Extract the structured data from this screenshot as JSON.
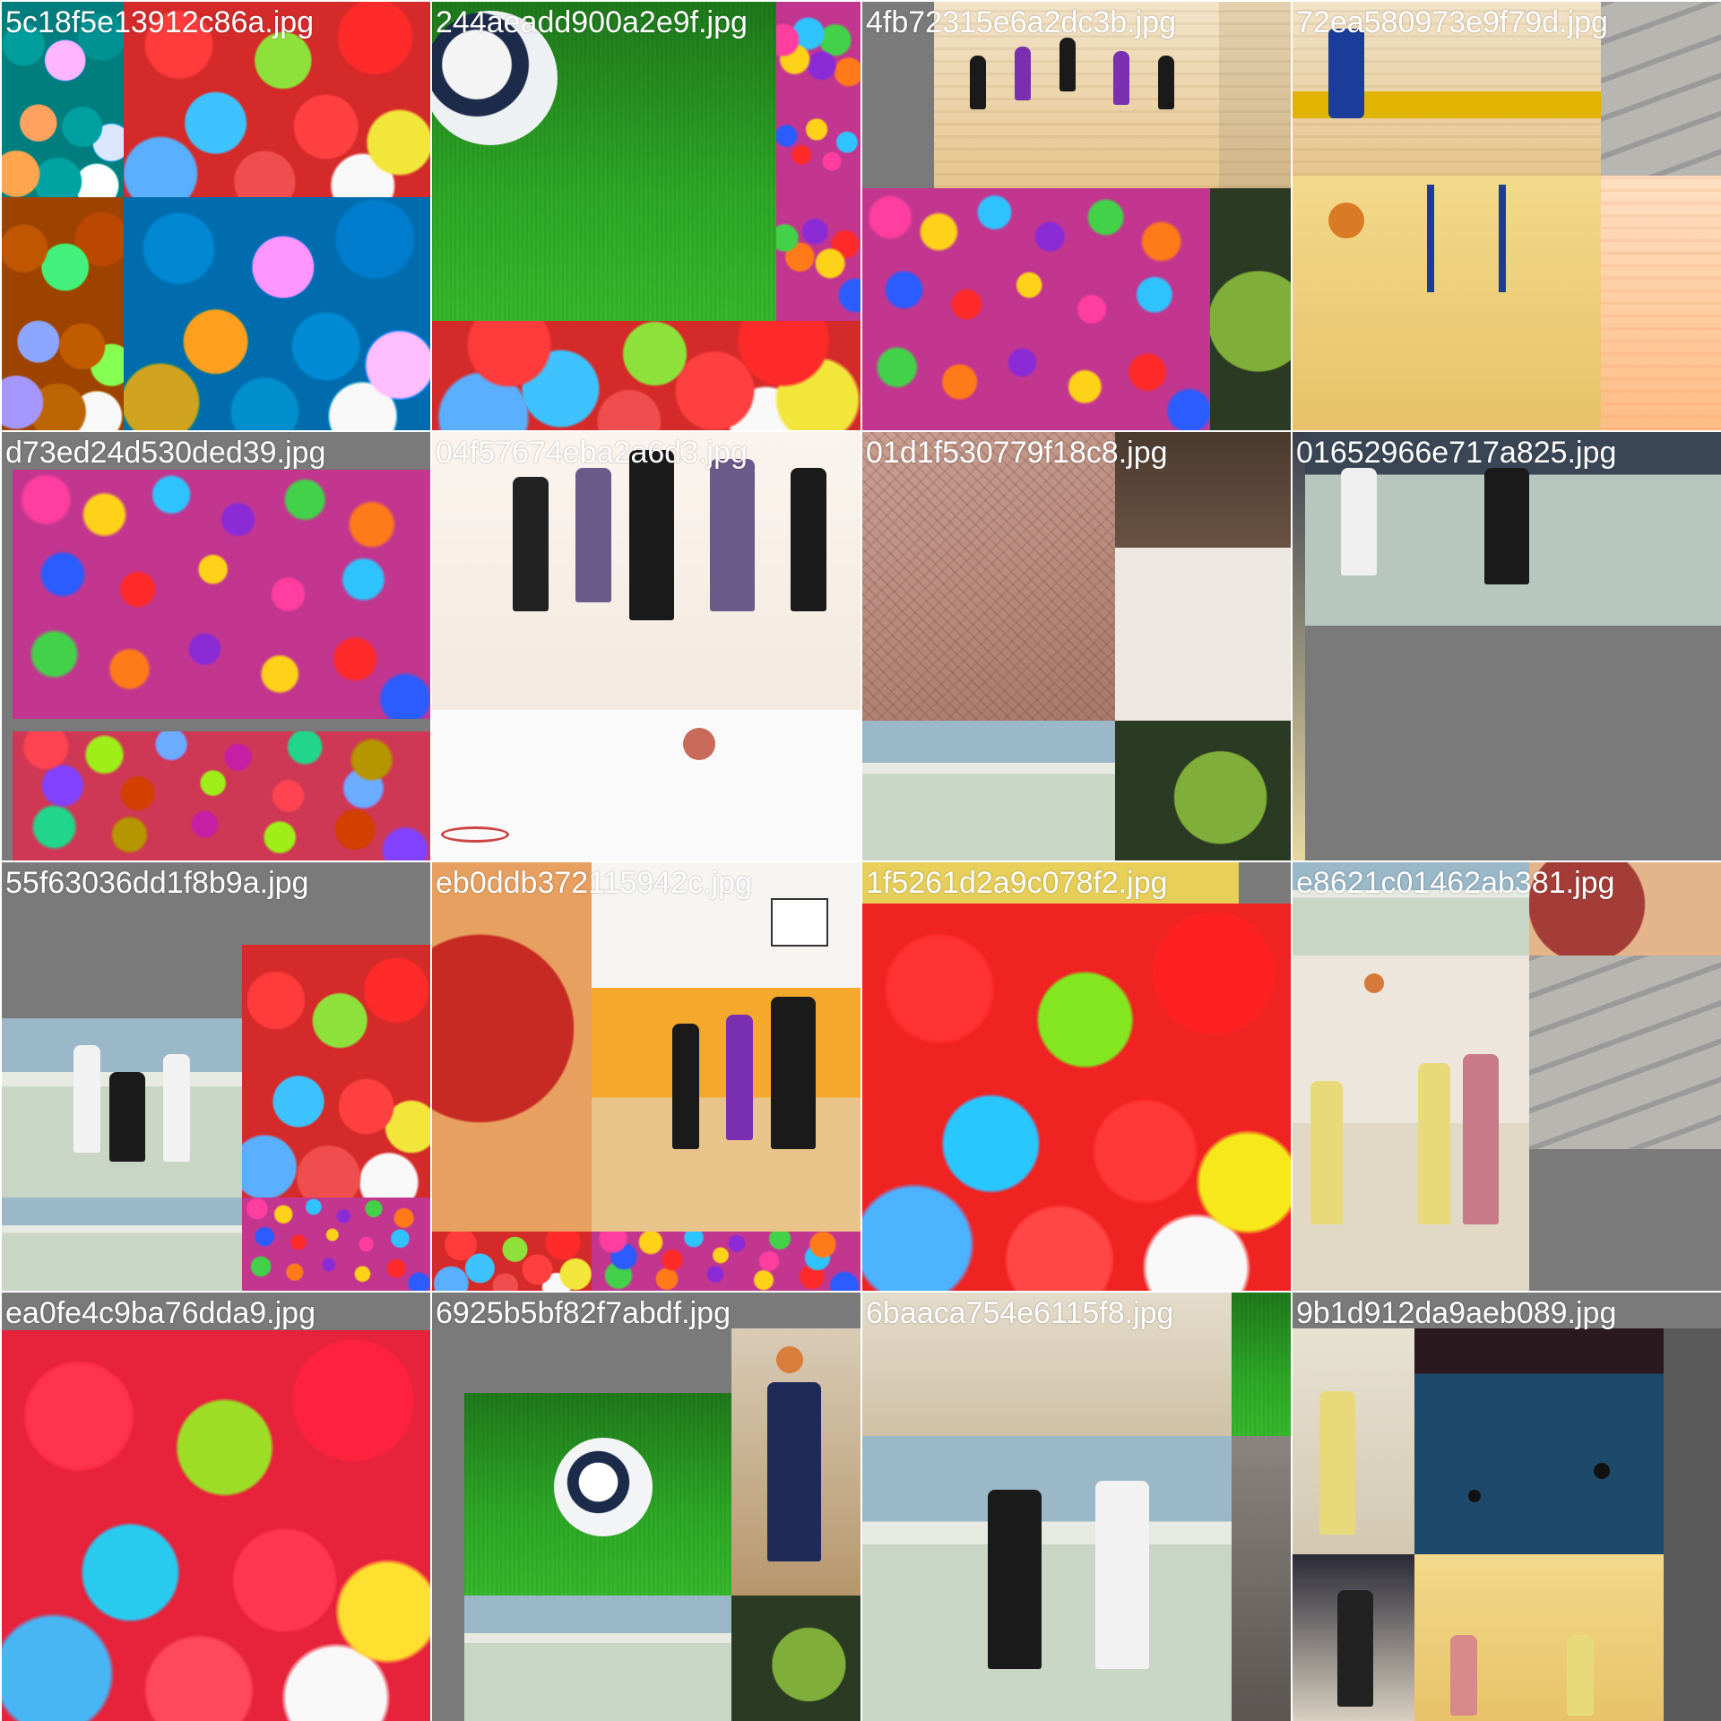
{
  "tiles": [
    {
      "filename": "5c18f5e13912c86a.jpg",
      "subject": "candy balls"
    },
    {
      "filename": "244aeadd900a2e9f.jpg",
      "subject": "soccer ball on grass"
    },
    {
      "filename": "4fb72315e6a2dc3b.jpg",
      "subject": "basketball and ball pit"
    },
    {
      "filename": "72ea580973e9f79d.jpg",
      "subject": "gym and basketball"
    },
    {
      "filename": "d73ed24d530ded39.jpg",
      "subject": "ball pit children"
    },
    {
      "filename": "04f57674eba2a6d3.jpg",
      "subject": "basketball players"
    },
    {
      "filename": "01d1f530779f18c8.jpg",
      "subject": "city model and crowd"
    },
    {
      "filename": "01652966e717a825.jpg",
      "subject": "floorball players"
    },
    {
      "filename": "55f63036dd1f8b9a.jpg",
      "subject": "floorball and candy"
    },
    {
      "filename": "eb0ddb372115942c.jpg",
      "subject": "tennis ball and basketball"
    },
    {
      "filename": "1f5261d2a9c078f2.jpg",
      "subject": "candy balls closeup"
    },
    {
      "filename": "e8621c01462ab381.jpg",
      "subject": "basketball gym ceiling"
    },
    {
      "filename": "ea0fe4c9ba76dda9.jpg",
      "subject": "candy balls"
    },
    {
      "filename": "6925b5bf82f7abdf.jpg",
      "subject": "soccer ball and player"
    },
    {
      "filename": "6baaca754e6115f8.jpg",
      "subject": "floorball match"
    },
    {
      "filename": "9b1d912da9aeb089.jpg",
      "subject": "basketball and pool table"
    }
  ]
}
